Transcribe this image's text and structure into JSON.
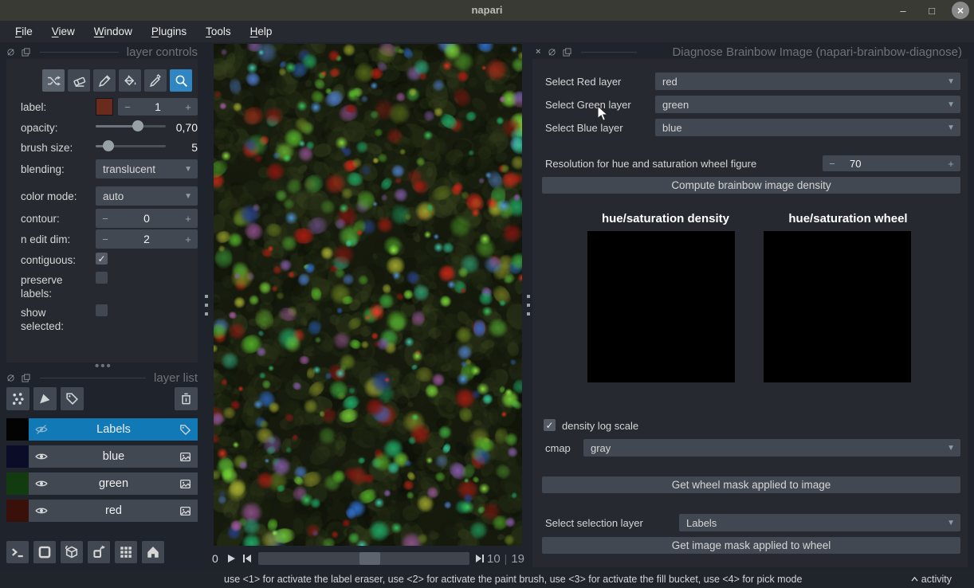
{
  "window": {
    "title": "napari",
    "minimize": "–",
    "maximize": "□",
    "close": "×"
  },
  "menu": {
    "items": [
      "File",
      "View",
      "Window",
      "Plugins",
      "Tools",
      "Help"
    ]
  },
  "left_dock": {
    "controls": {
      "title": "layer controls",
      "tools": [
        {
          "name": "shuffle-colors",
          "state": "active"
        },
        {
          "name": "eraser",
          "state": ""
        },
        {
          "name": "paint-brush",
          "state": ""
        },
        {
          "name": "fill-bucket",
          "state": ""
        },
        {
          "name": "color-picker",
          "state": ""
        },
        {
          "name": "zoom-pan",
          "state": "selected"
        }
      ],
      "fields": {
        "label": {
          "label": "label:",
          "value": "1",
          "swatch_color": "#6b2b1c"
        },
        "opacity": {
          "label": "opacity:",
          "value": "0,70",
          "fraction": 0.6
        },
        "brush_size": {
          "label": "brush size:",
          "value": "5",
          "fraction": 0.18
        },
        "blending": {
          "label": "blending:",
          "value": "translucent"
        },
        "color_mode": {
          "label": "color mode:",
          "value": "auto"
        },
        "contour": {
          "label": "contour:",
          "value": "0"
        },
        "n_edit_dim": {
          "label": "n edit dim:",
          "value": "2"
        },
        "contiguous": {
          "label": "contiguous:",
          "checked": true
        },
        "preserve_labels": {
          "label": "preserve labels:",
          "checked": false
        },
        "show_selected": {
          "label": "show selected:",
          "checked": false
        }
      }
    },
    "layer_list": {
      "title": "layer list",
      "layers": [
        {
          "name": "Labels",
          "selected": true,
          "visible": false,
          "type": "labels",
          "thumb": "#030303"
        },
        {
          "name": "blue",
          "selected": false,
          "visible": true,
          "type": "image",
          "thumb": "#0a0c28"
        },
        {
          "name": "green",
          "selected": false,
          "visible": true,
          "type": "image",
          "thumb": "#123c10"
        },
        {
          "name": "red",
          "selected": false,
          "visible": true,
          "type": "image",
          "thumb": "#39100a"
        }
      ]
    },
    "viewer_buttons": [
      "console",
      "toggle-ndisplay",
      "roll-dimensions",
      "transpose-dimensions",
      "grid-view",
      "home"
    ]
  },
  "canvas": {
    "background": "#151a0d",
    "palette": [
      "#b01c12",
      "#8b1510",
      "#d42818",
      "#4f9d2f",
      "#7ddc3a",
      "#3fae3f",
      "#57b82a",
      "#1fae6a",
      "#35d0a0",
      "#2f6fd0",
      "#27408b",
      "#4f7fd0",
      "#8a5fb0",
      "#b05fb0",
      "#a8b030",
      "#8a9427",
      "#67801f",
      "#4f9d2f",
      "#57b82a",
      "#1fae6a"
    ],
    "mottle": [
      "#2a3318",
      "#1c2412",
      "#33401c",
      "#141a0c",
      "#0a0d06",
      "#3a4520",
      "#262e14"
    ]
  },
  "dims": {
    "axis_label": "0",
    "current": "10",
    "separator": "|",
    "total": "19",
    "fraction": 0.53
  },
  "plugin_panel": {
    "title": "Diagnose Brainbow Image (napari-brainbow-diagnose)",
    "rows": [
      {
        "label": "Select Red layer",
        "value": "red"
      },
      {
        "label": "Select Green layer",
        "value": "green"
      },
      {
        "label": "Select Blue layer",
        "value": "blue"
      }
    ],
    "resolution": {
      "label": "Resolution for hue and saturation wheel figure",
      "value": "70"
    },
    "compute_button": "Compute brainbow image density",
    "figures": [
      {
        "title": "hue/saturation density"
      },
      {
        "title": "hue/saturation wheel"
      }
    ],
    "density_log": {
      "label": "density log scale",
      "checked": true
    },
    "cmap": {
      "label": "cmap",
      "value": "gray"
    },
    "wheel_mask_button": "Get wheel mask applied to image",
    "selection_layer": {
      "label": "Select selection layer",
      "value": "Labels"
    },
    "image_mask_button": "Get image mask applied to wheel"
  },
  "status_bar": {
    "message": "use <1> for activate the label eraser, use <2> for activate the paint brush, use <3> for activate the fill bucket, use <4> for pick mode",
    "activity_label": "activity"
  },
  "colors": {
    "accent": "#2f86c2",
    "selection": "#1179b5",
    "widget": "#414851",
    "background": "#262930",
    "page": "#1f232b",
    "text": "#d6d6d6",
    "title_text": "#6f7277"
  }
}
